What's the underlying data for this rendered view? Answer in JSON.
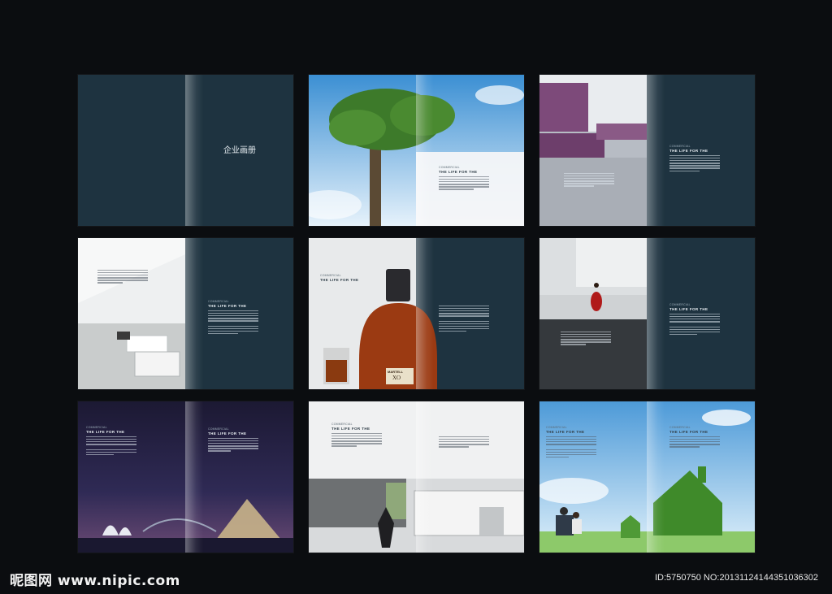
{
  "cover": {
    "title": "企业画册"
  },
  "spread_text": {
    "eyebrow": "COMMERCIAL",
    "heading": "THE LIFE FOR THE"
  },
  "bottle_labels": {
    "brand": "MARTELL",
    "grade": "XO"
  },
  "footer": {
    "watermark": "昵图网 www.nipic.com",
    "id_line": "ID:5750750 NO:20131124144351036302"
  },
  "colors": {
    "background": "#0b0d10",
    "panel": "#1e3340",
    "accent_text": "#e8eef2"
  }
}
